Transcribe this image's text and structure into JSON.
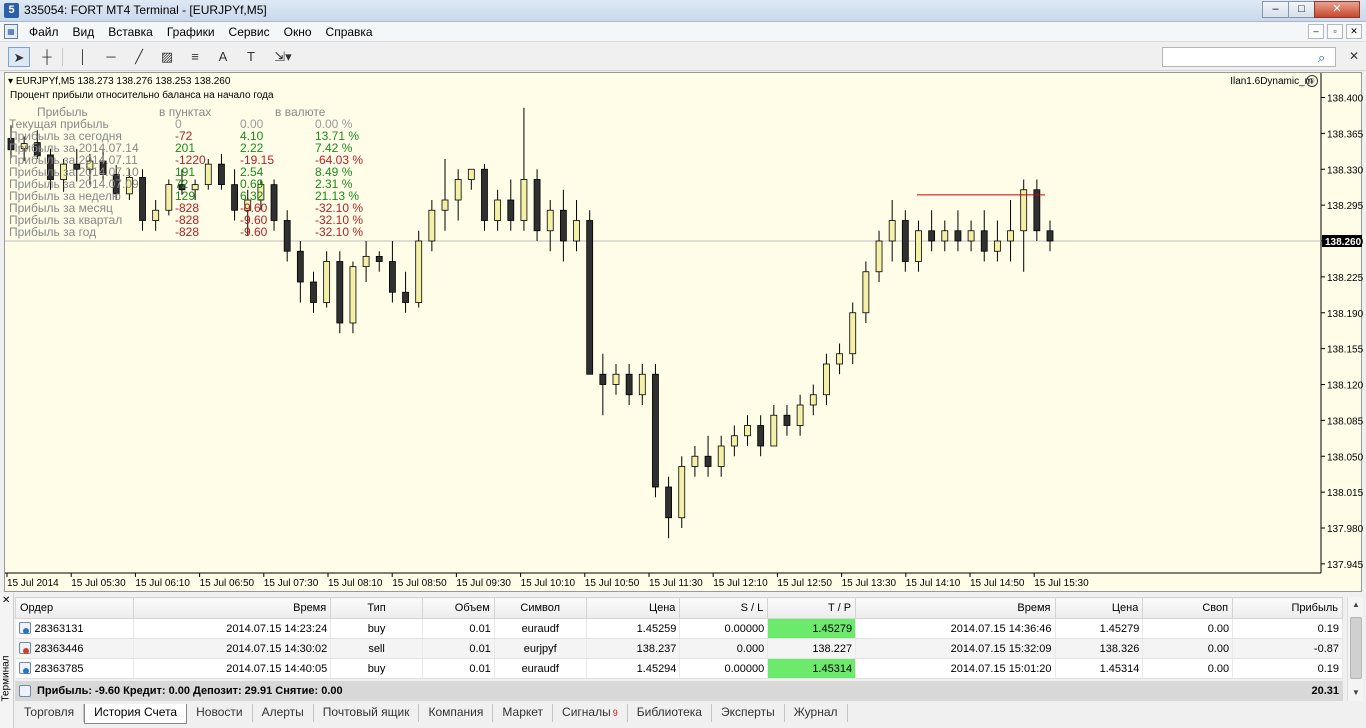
{
  "window": {
    "title": "335054: FORT MT4 Terminal - [EURJPYf,M5]",
    "app_icon": "5",
    "min": "–",
    "max": "□",
    "close": "✕"
  },
  "menu": {
    "items": [
      "Файл",
      "Вид",
      "Вставка",
      "Графики",
      "Сервис",
      "Окно",
      "Справка"
    ],
    "mdi": [
      "–",
      "▫",
      "✕"
    ]
  },
  "toolbar": {
    "tools": [
      "cursor-arrow-icon",
      "crosshair-icon",
      "vertical-line-icon",
      "horizontal-line-icon",
      "trend-line-icon",
      "equidistant-channel-icon",
      "fibonacci-icon",
      "text-icon",
      "text-label-icon",
      "arrow-objects-icon"
    ],
    "search_placeholder": ""
  },
  "chart": {
    "header": "EURJPYf,M5  138.273 138.276 138.253 138.260",
    "subtitle": "Процент прибыли относительно баланса на начало года",
    "ea": "Ilan1.6Dynamic_m",
    "stats_head": [
      "Прибыль",
      "в пунктах",
      "в валюте"
    ],
    "stats_rows": [
      {
        "label": "Текущая прибыль",
        "p": "0",
        "p2": "0.00",
        "cur": "0.00 %",
        "cls": "neu"
      },
      {
        "label": "Прибыль за сегодня",
        "p": "-72",
        "p2": "4.10",
        "cur": "13.71 %",
        "cls": "mixed"
      },
      {
        "label": "Прибыль за 2014.07.14",
        "p": "201",
        "p2": "2.22",
        "cur": "7.42 %",
        "cls": "pos"
      },
      {
        "label": "Прибыль за 2014.07.11",
        "p": "-1220",
        "p2": "-19.15",
        "cur": "-64.03 %",
        "cls": "neg"
      },
      {
        "label": "Прибыль за 2014.07.10",
        "p": "191",
        "p2": "2.54",
        "cur": "8.49 %",
        "cls": "pos"
      },
      {
        "label": "Прибыль за 2014.07.09",
        "p": "72",
        "p2": "0.69",
        "cur": "2.31 %",
        "cls": "pos"
      },
      {
        "label": "Прибыль за неделю",
        "p": "129",
        "p2": "6.32",
        "cur": "21.13 %",
        "cls": "pos"
      },
      {
        "label": "Прибыль за месяц",
        "p": "-828",
        "p2": "-9.60",
        "cur": "-32.10 %",
        "cls": "neg"
      },
      {
        "label": "Прибыль за квартал",
        "p": "-828",
        "p2": "-9.60",
        "cur": "-32.10 %",
        "cls": "neg"
      },
      {
        "label": "Прибыль за год",
        "p": "-828",
        "p2": "-9.60",
        "cur": "-32.10 %",
        "cls": "neg"
      }
    ]
  },
  "chart_data": {
    "type": "candlestick",
    "symbol": "EURJPYf",
    "timeframe": "M5",
    "ylim": [
      137.94,
      138.42
    ],
    "y_ticks": [
      "138.400",
      "138.365",
      "138.330",
      "138.295",
      "138.260",
      "138.225",
      "138.190",
      "138.155",
      "138.120",
      "138.085",
      "138.050",
      "138.015",
      "137.980",
      "137.945"
    ],
    "current_price": "138.260",
    "x_ticks": [
      "15 Jul 2014",
      "15 Jul 05:30",
      "15 Jul 06:10",
      "15 Jul 06:50",
      "15 Jul 07:30",
      "15 Jul 08:10",
      "15 Jul 08:50",
      "15 Jul 09:30",
      "15 Jul 10:10",
      "15 Jul 10:50",
      "15 Jul 11:30",
      "15 Jul 12:10",
      "15 Jul 12:50",
      "15 Jul 13:30",
      "15 Jul 14:10",
      "15 Jul 14:50",
      "15 Jul 15:30"
    ],
    "tp_line": 138.305,
    "candles": [
      [
        138.36,
        138.373,
        138.341,
        138.349
      ],
      [
        138.35,
        138.362,
        138.338,
        138.355
      ],
      [
        138.356,
        138.368,
        138.34,
        138.343
      ],
      [
        138.344,
        138.35,
        138.31,
        138.32
      ],
      [
        138.32,
        138.34,
        138.308,
        138.335
      ],
      [
        138.335,
        138.35,
        138.318,
        138.33
      ],
      [
        138.33,
        138.345,
        138.315,
        138.338
      ],
      [
        138.338,
        138.35,
        138.32,
        138.325
      ],
      [
        138.325,
        138.334,
        138.3,
        138.306
      ],
      [
        138.306,
        138.33,
        138.3,
        138.322
      ],
      [
        138.322,
        138.33,
        138.27,
        138.28
      ],
      [
        138.28,
        138.3,
        138.27,
        138.29
      ],
      [
        138.29,
        138.32,
        138.285,
        138.315
      ],
      [
        138.315,
        138.33,
        138.305,
        138.31
      ],
      [
        138.31,
        138.32,
        138.3,
        138.315
      ],
      [
        138.315,
        138.34,
        138.31,
        138.335
      ],
      [
        138.335,
        138.345,
        138.31,
        138.315
      ],
      [
        138.315,
        138.33,
        138.28,
        138.29
      ],
      [
        138.29,
        138.31,
        138.265,
        138.3
      ],
      [
        138.3,
        138.32,
        138.29,
        138.315
      ],
      [
        138.315,
        138.32,
        138.27,
        138.28
      ],
      [
        138.28,
        138.29,
        138.24,
        138.25
      ],
      [
        138.25,
        138.26,
        138.2,
        138.22
      ],
      [
        138.22,
        138.23,
        138.19,
        138.2
      ],
      [
        138.2,
        138.25,
        138.195,
        138.24
      ],
      [
        138.24,
        138.25,
        138.17,
        138.18
      ],
      [
        138.18,
        138.24,
        138.17,
        138.235
      ],
      [
        138.235,
        138.26,
        138.22,
        138.245
      ],
      [
        138.245,
        138.25,
        138.23,
        138.24
      ],
      [
        138.24,
        138.26,
        138.2,
        138.21
      ],
      [
        138.21,
        138.23,
        138.19,
        138.2
      ],
      [
        138.2,
        138.27,
        138.195,
        138.26
      ],
      [
        138.26,
        138.3,
        138.25,
        138.29
      ],
      [
        138.29,
        138.34,
        138.27,
        138.3
      ],
      [
        138.3,
        138.33,
        138.28,
        138.32
      ],
      [
        138.32,
        138.33,
        138.31,
        138.33
      ],
      [
        138.33,
        138.335,
        138.27,
        138.28
      ],
      [
        138.28,
        138.31,
        138.27,
        138.3
      ],
      [
        138.3,
        138.32,
        138.27,
        138.28
      ],
      [
        138.28,
        138.39,
        138.27,
        138.32
      ],
      [
        138.32,
        138.33,
        138.26,
        138.27
      ],
      [
        138.27,
        138.3,
        138.25,
        138.29
      ],
      [
        138.29,
        138.31,
        138.24,
        138.26
      ],
      [
        138.26,
        138.3,
        138.25,
        138.28
      ],
      [
        138.28,
        138.29,
        138.16,
        138.13
      ],
      [
        138.13,
        138.15,
        138.09,
        138.12
      ],
      [
        138.12,
        138.14,
        138.11,
        138.13
      ],
      [
        138.13,
        138.14,
        138.1,
        138.11
      ],
      [
        138.11,
        138.14,
        138.1,
        138.13
      ],
      [
        138.13,
        138.14,
        138.01,
        138.02
      ],
      [
        138.02,
        138.03,
        137.97,
        137.99
      ],
      [
        137.99,
        138.05,
        137.98,
        138.04
      ],
      [
        138.04,
        138.06,
        138.03,
        138.05
      ],
      [
        138.05,
        138.07,
        138.03,
        138.04
      ],
      [
        138.04,
        138.07,
        138.03,
        138.06
      ],
      [
        138.06,
        138.08,
        138.05,
        138.07
      ],
      [
        138.07,
        138.09,
        138.06,
        138.08
      ],
      [
        138.08,
        138.09,
        138.05,
        138.06
      ],
      [
        138.06,
        138.1,
        138.06,
        138.09
      ],
      [
        138.09,
        138.1,
        138.07,
        138.08
      ],
      [
        138.08,
        138.11,
        138.07,
        138.1
      ],
      [
        138.1,
        138.12,
        138.09,
        138.11
      ],
      [
        138.11,
        138.15,
        138.1,
        138.14
      ],
      [
        138.14,
        138.16,
        138.13,
        138.15
      ],
      [
        138.15,
        138.2,
        138.14,
        138.19
      ],
      [
        138.19,
        138.24,
        138.18,
        138.23
      ],
      [
        138.23,
        138.27,
        138.22,
        138.26
      ],
      [
        138.26,
        138.3,
        138.24,
        138.28
      ],
      [
        138.28,
        138.29,
        138.23,
        138.24
      ],
      [
        138.24,
        138.28,
        138.23,
        138.27
      ],
      [
        138.27,
        138.29,
        138.25,
        138.26
      ],
      [
        138.26,
        138.28,
        138.25,
        138.27
      ],
      [
        138.27,
        138.29,
        138.25,
        138.26
      ],
      [
        138.26,
        138.28,
        138.25,
        138.27
      ],
      [
        138.27,
        138.29,
        138.24,
        138.25
      ],
      [
        138.25,
        138.28,
        138.24,
        138.26
      ],
      [
        138.26,
        138.3,
        138.24,
        138.27
      ],
      [
        138.27,
        138.32,
        138.23,
        138.31
      ],
      [
        138.31,
        138.32,
        138.26,
        138.27
      ],
      [
        138.27,
        138.28,
        138.25,
        138.26
      ]
    ]
  },
  "terminal": {
    "side_label": "Терминал",
    "close": "✕",
    "columns": [
      "Ордер",
      "Время",
      "Тип",
      "Объем",
      "Символ",
      "Цена",
      "S / L",
      "T / P",
      "Время",
      "Цена",
      "Своп",
      "Прибыль"
    ],
    "rows": [
      {
        "order": "28363131",
        "kind": "buy",
        "open": "2014.07.15 14:23:24",
        "type": "buy",
        "vol": "0.01",
        "sym": "euraudf",
        "price": "1.45259",
        "sl": "0.00000",
        "tp": "1.45279",
        "tp_hit": true,
        "close": "2014.07.15 14:36:46",
        "cprice": "1.45279",
        "swap": "0.00",
        "profit": "0.19"
      },
      {
        "order": "28363446",
        "kind": "sell",
        "open": "2014.07.15 14:30:02",
        "type": "sell",
        "vol": "0.01",
        "sym": "eurjpyf",
        "price": "138.237",
        "sl": "0.000",
        "tp": "138.227",
        "tp_hit": false,
        "close": "2014.07.15 15:32:09",
        "cprice": "138.326",
        "swap": "0.00",
        "profit": "-0.87"
      },
      {
        "order": "28363785",
        "kind": "buy",
        "open": "2014.07.15 14:40:05",
        "type": "buy",
        "vol": "0.01",
        "sym": "euraudf",
        "price": "1.45294",
        "sl": "0.00000",
        "tp": "1.45314",
        "tp_hit": true,
        "close": "2014.07.15 15:01:20",
        "cprice": "1.45314",
        "swap": "0.00",
        "profit": "0.19"
      }
    ],
    "summary": "Прибыль: -9.60  Кредит: 0.00  Депозит: 29.91  Снятие: 0.00",
    "summary_total": "20.31",
    "tabs": [
      "Торговля",
      "История Счета",
      "Новости",
      "Алерты",
      "Почтовый ящик",
      "Компания",
      "Маркет",
      "Сигналы",
      "Библиотека",
      "Эксперты",
      "Журнал"
    ],
    "active_tab": 1,
    "signals_badge": "9"
  }
}
